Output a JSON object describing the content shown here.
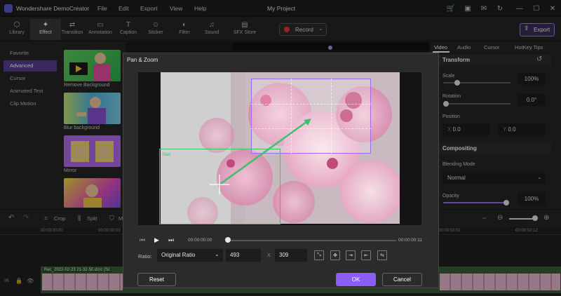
{
  "app": {
    "name": "Wondershare DemoCreator",
    "project_title": "My Project"
  },
  "menu": [
    "File",
    "Edit",
    "Export",
    "View",
    "Help"
  ],
  "toolbar": {
    "tools": [
      {
        "label": "Library",
        "icon": "library-icon"
      },
      {
        "label": "Effect",
        "icon": "effect-icon"
      },
      {
        "label": "Transition",
        "icon": "transition-icon"
      },
      {
        "label": "Annotation",
        "icon": "annotation-icon"
      },
      {
        "label": "Caption",
        "icon": "caption-icon"
      },
      {
        "label": "Sticker",
        "icon": "sticker-icon"
      },
      {
        "label": "Filter",
        "icon": "filter-icon"
      },
      {
        "label": "Sound",
        "icon": "sound-icon"
      },
      {
        "label": "SFX Store",
        "icon": "sfx-store-icon"
      }
    ],
    "record_label": "Record",
    "export_label": "Export"
  },
  "left_nav": [
    "Favorite",
    "Advanced",
    "Cursor",
    "Animated Text",
    "Clip Motion"
  ],
  "effects": [
    "Remove Background",
    "Blur background",
    "Mirror"
  ],
  "right_panel": {
    "tabs": [
      "Video",
      "Audio",
      "Cursor",
      "HotKey Tips"
    ],
    "transform_title": "Transform",
    "scale_label": "Scale",
    "scale_value": "100%",
    "rotation_label": "Rotation",
    "rotation_value": "0.0°",
    "position_label": "Position",
    "pos_x_label": "X",
    "pos_x_value": "0.0",
    "pos_y_label": "Y",
    "pos_y_value": "0.0",
    "compositing_title": "Compositing",
    "blending_label": "Blending Mode",
    "blending_value": "Normal",
    "opacity_label": "Opacity",
    "opacity_value": "100%"
  },
  "bottom_bar": {
    "crop_label": "Crop",
    "split_label": "Split",
    "extra_label": "M"
  },
  "timeline": {
    "times": [
      "00:00:00:00",
      "00:00:00:00",
      "00:00:02:02",
      "00:00:02:12"
    ],
    "clip_name": "Rec_2022-02-23 21-32-50.dcrc (Sc"
  },
  "dialog": {
    "title": "Pan & Zoom",
    "start_label": "Start",
    "time_current": "00:00:00:00",
    "time_total": "00:00:00:11",
    "ratio_label": "Ratio:",
    "ratio_value": "Original Ratio",
    "width_value": "493",
    "times_sign": "X",
    "height_value": "309",
    "reset_label": "Reset",
    "ok_label": "OK",
    "cancel_label": "Cancel"
  },
  "colors": {
    "accent": "#8b5cf6",
    "start_box": "#3fbf6f",
    "end_box": "#9a6df0"
  }
}
